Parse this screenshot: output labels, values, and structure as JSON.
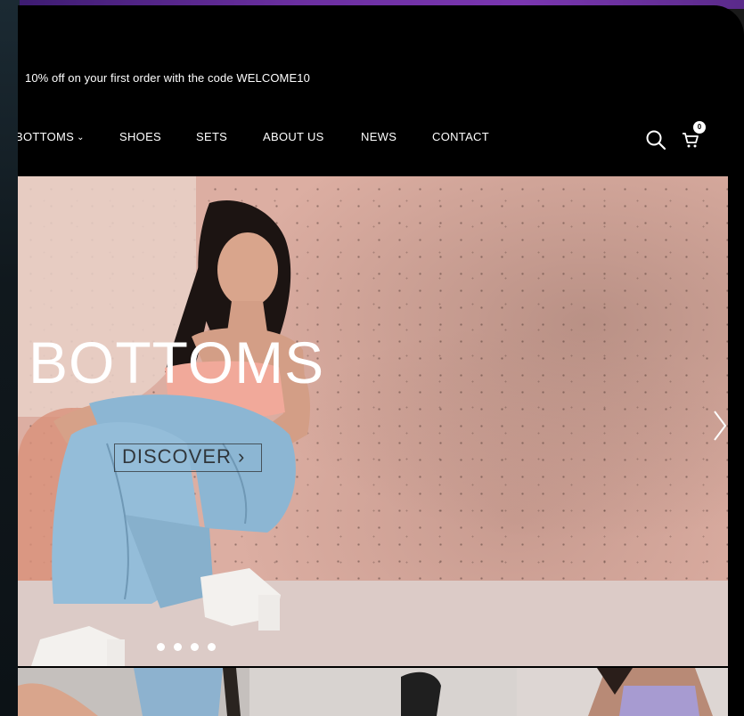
{
  "announcement": "10% off on your first order with the code WELCOME10",
  "nav": {
    "items": [
      {
        "label": "BOTTOMS",
        "has_dropdown": true
      },
      {
        "label": "SHOES"
      },
      {
        "label": "SETS"
      },
      {
        "label": "ABOUT US"
      },
      {
        "label": "NEWS"
      },
      {
        "label": "CONTACT"
      }
    ],
    "chevron": "⌄",
    "search_icon": "search-icon",
    "cart_icon": "cart-icon",
    "cart_count": "0"
  },
  "hero": {
    "title": "BOTTOMS",
    "cta_label": "DISCOVER",
    "cta_arrow": "›",
    "slide_count": 4,
    "active_slide": 1
  },
  "colors": {
    "header_bg": "#000000",
    "hero_bg": "#dcaea2",
    "text_light": "#ffffff"
  }
}
